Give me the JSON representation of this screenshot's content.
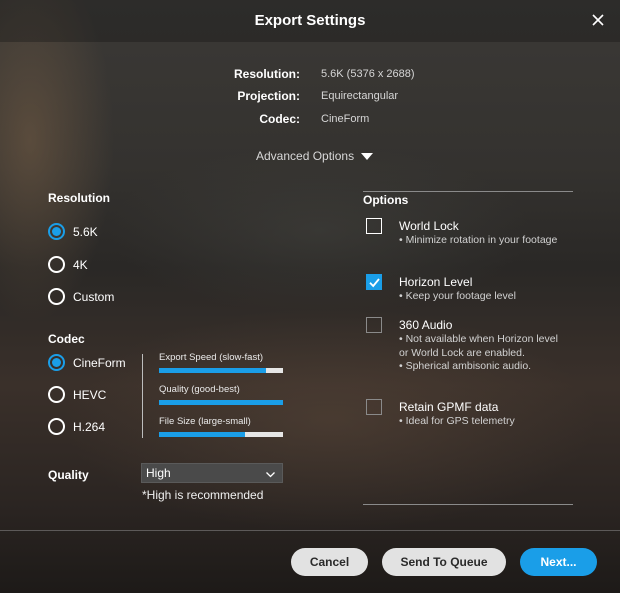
{
  "window": {
    "title": "Export Settings"
  },
  "summary": [
    {
      "label": "Resolution:",
      "value": "5.6K (5376 x 2688)"
    },
    {
      "label": "Projection:",
      "value": "Equirectangular"
    },
    {
      "label": "Codec:",
      "value": "CineForm"
    }
  ],
  "advanced_options": {
    "label": "Advanced Options"
  },
  "resolution": {
    "title": "Resolution",
    "options": [
      "5.6K",
      "4K",
      "Custom"
    ],
    "selected": "5.6K"
  },
  "codec": {
    "title": "Codec",
    "options": [
      "CineForm",
      "HEVC",
      "H.264"
    ],
    "selected": "CineForm",
    "meters": [
      {
        "label": "Export Speed (slow-fast)",
        "value": 0.86
      },
      {
        "label": "Quality (good-best)",
        "value": 1.0
      },
      {
        "label": "File Size (large-small)",
        "value": 0.69
      }
    ]
  },
  "quality": {
    "title": "Quality",
    "selected": "High",
    "hint": "*High is recommended"
  },
  "options": {
    "title": "Options",
    "items": [
      {
        "name": "World Lock",
        "desc": "• Minimize rotation in your footage",
        "checked": false,
        "disabled": false
      },
      {
        "name": "Horizon Level",
        "desc": "• Keep your footage level",
        "checked": true,
        "disabled": false
      },
      {
        "name": "360 Audio",
        "desc": "• Not available when Horizon level or World Lock are enabled.\n• Spherical ambisonic audio.",
        "checked": false,
        "disabled": true
      },
      {
        "name": "Retain GPMF data",
        "desc": "• Ideal for GPS telemetry",
        "checked": false,
        "disabled": true
      }
    ]
  },
  "buttons": {
    "cancel": "Cancel",
    "queue": "Send To Queue",
    "next": "Next..."
  },
  "colors": {
    "accent": "#1a9ee8",
    "button_light": "#e2e2e2"
  }
}
